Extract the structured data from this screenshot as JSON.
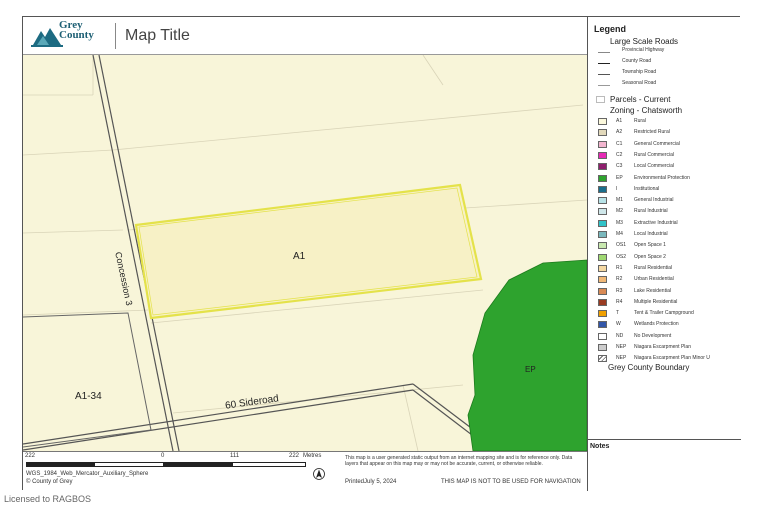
{
  "header": {
    "logo_line1": "Grey",
    "logo_line2": "County",
    "map_title": "Map Title"
  },
  "map_labels": {
    "road_concession": "Concession 3",
    "road_sideroad": "60 Sideroad",
    "zone_a1": "A1",
    "zone_a1_34": "A1-34",
    "zone_ep": "EP"
  },
  "colors": {
    "background_zone": "#f8f5d9",
    "parcel_outline": "#e4e24a",
    "ep_green": "#2ea32e",
    "parcel_lines": "#d9d4b8"
  },
  "scale": {
    "labels": [
      "222",
      "0",
      "111",
      "222"
    ],
    "units": "Metres"
  },
  "footer": {
    "projection": "WGS_1984_Web_Mercator_Auxiliary_Sphere",
    "copyright": "© County of Grey",
    "disclaimer": "This map is a user generated static output from an internet mapping site and is for reference only. Data layers that appear on this map may or may not be accurate, current, or otherwise reliable.",
    "printed": "PrintedJuly 5, 2024",
    "not_for_navigation": "THIS MAP IS NOT TO BE USED FOR NAVIGATION"
  },
  "legend": {
    "title": "Legend",
    "roads_title": "Large Scale Roads",
    "roads": [
      {
        "label": "Provincial Highway",
        "color": "#888888",
        "width": 1
      },
      {
        "label": "County Road",
        "color": "#222222",
        "width": 1.5
      },
      {
        "label": "Township Road",
        "color": "#555555",
        "width": 1
      },
      {
        "label": "Seasonal Road",
        "color": "#999999",
        "width": 1
      }
    ],
    "parcels_title": "Parcels - Current",
    "zoning_title": "Zoning - Chatsworth",
    "zones": [
      {
        "code": "A1",
        "label": "Rural",
        "color": "#fbf8dc"
      },
      {
        "code": "A2",
        "label": "Restricted Rural",
        "color": "#e2d9bb"
      },
      {
        "code": "C1",
        "label": "General Commercial",
        "color": "#f2b5cf"
      },
      {
        "code": "C2",
        "label": "Rural Commercial",
        "color": "#e62ab5"
      },
      {
        "code": "C3",
        "label": "Local Commercial",
        "color": "#8e1e6d"
      },
      {
        "code": "EP",
        "label": "Environmental Protection",
        "color": "#2ea32e"
      },
      {
        "code": "I",
        "label": "Institutional",
        "color": "#1a6e8c"
      },
      {
        "code": "M1",
        "label": "General Industrial",
        "color": "#b8e3e8"
      },
      {
        "code": "M2",
        "label": "Rural Industrial",
        "color": "#cfe7ea"
      },
      {
        "code": "M3",
        "label": "Extractive Industrial",
        "color": "#31c3c9"
      },
      {
        "code": "M4",
        "label": "Local Industrial",
        "color": "#7ab8bd"
      },
      {
        "code": "OS1",
        "label": "Open Space 1",
        "color": "#c9e9b0"
      },
      {
        "code": "OS2",
        "label": "Open Space 2",
        "color": "#9fd872"
      },
      {
        "code": "R1",
        "label": "Rural Residential",
        "color": "#f5d9a3"
      },
      {
        "code": "R2",
        "label": "Urban Residential",
        "color": "#f0b877"
      },
      {
        "code": "R3",
        "label": "Lake Residential",
        "color": "#d98a55"
      },
      {
        "code": "R4",
        "label": "Multiple Residential",
        "color": "#9a3c22"
      },
      {
        "code": "T",
        "label": "Tent & Trailer Campground",
        "color": "#f0a000"
      },
      {
        "code": "W",
        "label": "Wetlands Protection",
        "color": "#3256a8"
      },
      {
        "code": "ND",
        "label": "No Development",
        "color": "#ffffff"
      },
      {
        "code": "NEP",
        "label": "Niagara Escarpment Plan",
        "color": "#cccccc"
      },
      {
        "code": "NEP",
        "label": "Niagara Escarpment Plan Minor U",
        "color": "hatch"
      }
    ],
    "boundary_title": "Grey County Boundary"
  },
  "notes": {
    "title": "Notes"
  },
  "watermark": "Licensed to RAGBOS"
}
